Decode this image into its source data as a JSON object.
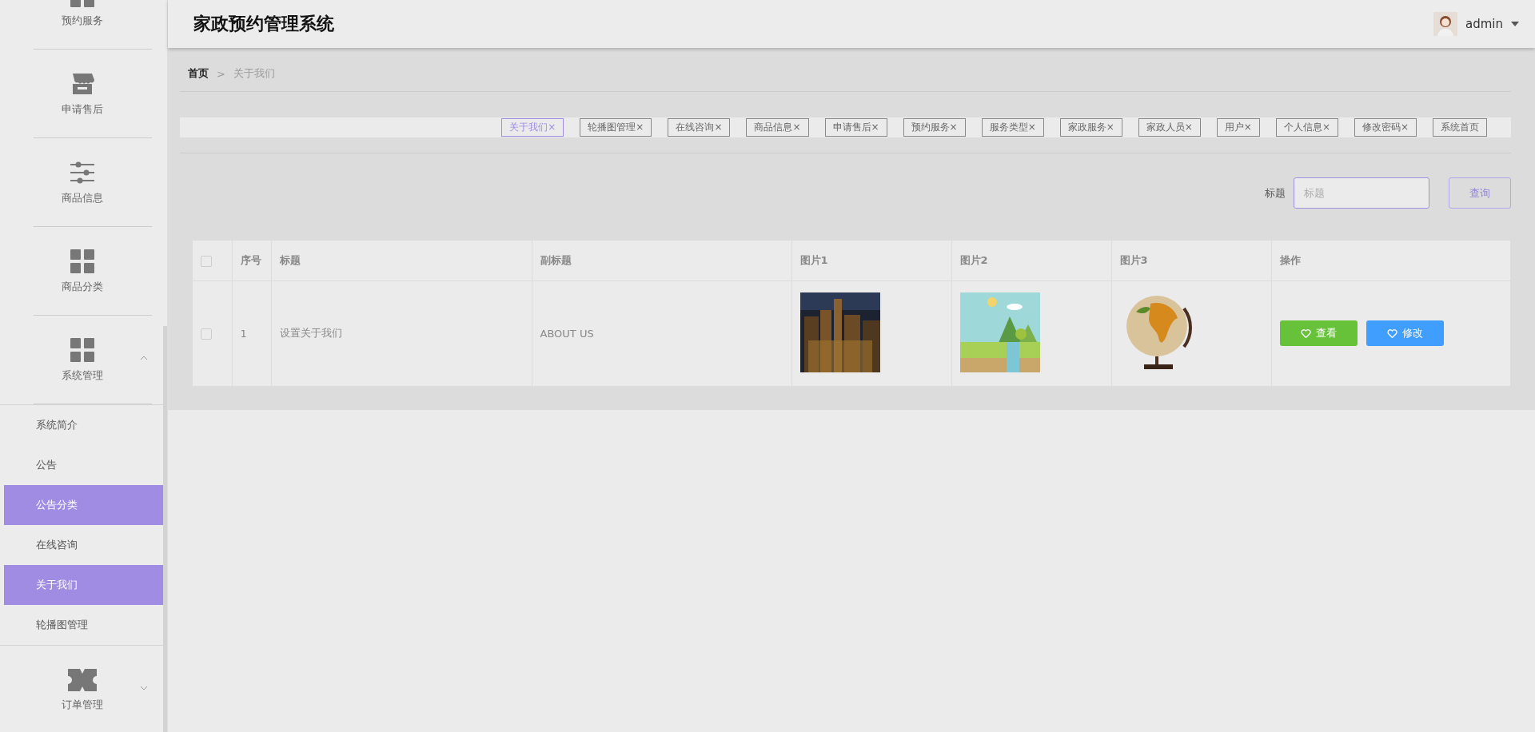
{
  "sidebar": {
    "items": [
      {
        "label": "预约服务"
      },
      {
        "label": "申请售后"
      },
      {
        "label": "商品信息"
      },
      {
        "label": "商品分类"
      },
      {
        "label": "系统管理",
        "expanded": true,
        "children": [
          {
            "label": "系统简介",
            "selected": false
          },
          {
            "label": "公告",
            "selected": false
          },
          {
            "label": "公告分类",
            "selected": true
          },
          {
            "label": "在线咨询",
            "selected": false
          },
          {
            "label": "关于我们",
            "selected": true
          },
          {
            "label": "轮播图管理",
            "selected": false
          }
        ]
      },
      {
        "label": "订单管理",
        "expanded": false
      }
    ]
  },
  "header": {
    "title": "家政预约管理系统",
    "user": "admin"
  },
  "breadcrumb": {
    "home": "首页",
    "separator": ">",
    "current": "关于我们"
  },
  "tags": [
    {
      "label": "关于我们",
      "close": "×",
      "selected": true
    },
    {
      "label": "轮播图管理",
      "close": "×",
      "selected": false
    },
    {
      "label": "在线咨询",
      "close": "×",
      "selected": false
    },
    {
      "label": "商品信息",
      "close": "×",
      "selected": false
    },
    {
      "label": "申请售后",
      "close": "×",
      "selected": false
    },
    {
      "label": "预约服务",
      "close": "×",
      "selected": false
    },
    {
      "label": "服务类型",
      "close": "×",
      "selected": false
    },
    {
      "label": "家政服务",
      "close": "×",
      "selected": false
    },
    {
      "label": "家政人员",
      "close": "×",
      "selected": false
    },
    {
      "label": "用户",
      "close": "×",
      "selected": false
    },
    {
      "label": "个人信息",
      "close": "×",
      "selected": false
    },
    {
      "label": "修改密码",
      "close": "×",
      "selected": false
    },
    {
      "label": "系统首页",
      "selected": false
    }
  ],
  "search": {
    "label": "标题",
    "placeholder": "标题",
    "button": "查询"
  },
  "table": {
    "all_checked": false,
    "columns": [
      "序号",
      "标题",
      "副标题",
      "图片1",
      "图片2",
      "图片3",
      "操作"
    ],
    "rows": [
      {
        "checked": false,
        "cells": [
          "1",
          "设置关于我们",
          "ABOUT US"
        ],
        "pictures": [
          {
            "kind": "picture"
          },
          {
            "kind": "picture"
          },
          {
            "kind": "picture"
          }
        ],
        "actions": [
          {
            "label": "查看",
            "kind": "view"
          },
          {
            "label": "修改",
            "kind": "edit"
          }
        ]
      }
    ]
  }
}
